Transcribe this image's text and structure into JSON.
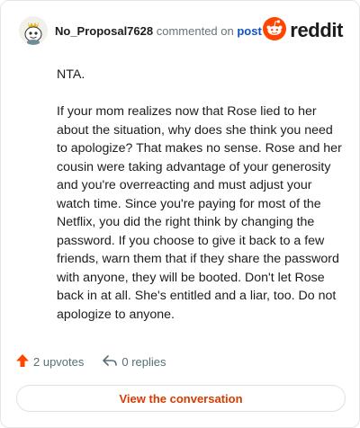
{
  "header": {
    "username": "No_Proposal7628",
    "action_text": "commented on",
    "post_link": "post",
    "brand": "reddit",
    "brand_color": "#ff4500",
    "icons": {
      "avatar": "snoo-avatar-icon",
      "brand": "reddit-logo-icon"
    }
  },
  "comment": {
    "paragraphs": [
      "NTA.",
      "If your mom realizes now that Rose lied to her about the situation, why does she think you need to apologize? That makes no sense. Rose and her cousin were taking advantage of your generosity and you're overreacting and must adjust your watch time. Since you're paying for most of the Netflix, you did the right think by changing the password. If you choose to give it back to a few friends, warn them that if they share the password with anyone, they will be booted. Don't let Rose back in at all. She's entitled and a liar, too. Do not apologize to anyone."
    ]
  },
  "footer": {
    "upvotes": "2 upvotes",
    "replies": "0 replies",
    "upvote_color": "#ff4500",
    "icons": {
      "upvote": "upvote-arrow-icon",
      "reply": "reply-arrow-icon"
    }
  },
  "cta": {
    "label": "View the conversation",
    "color": "#d93a00"
  }
}
